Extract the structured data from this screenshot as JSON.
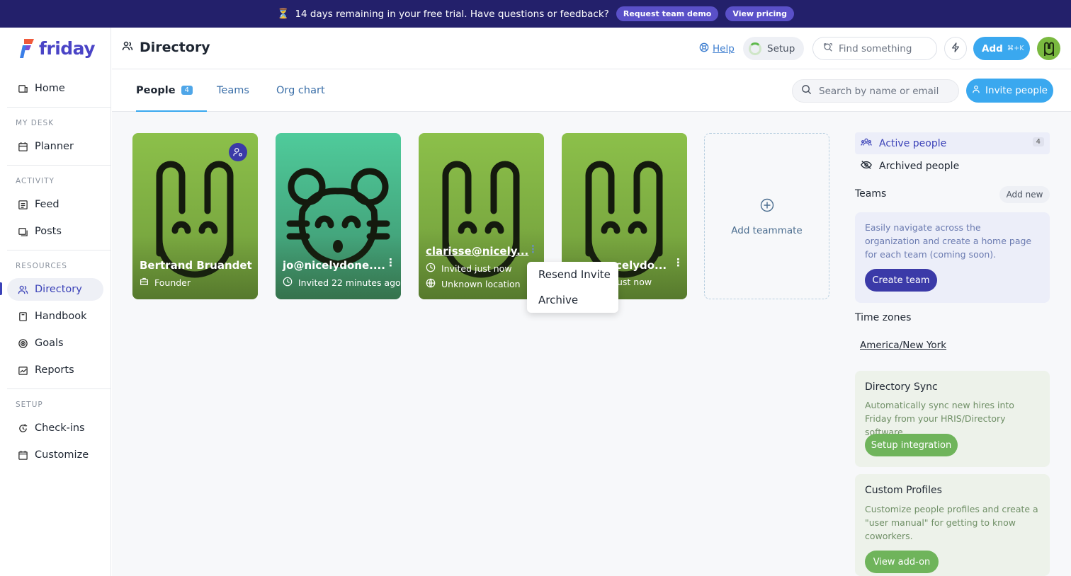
{
  "banner": {
    "message": "14 days remaining in your free trial. Have questions or feedback?",
    "demo_label": "Request team demo",
    "pricing_label": "View pricing"
  },
  "brand": {
    "name": "friday",
    "color": "#4a44c6"
  },
  "sidebar": {
    "home": "Home",
    "sections": [
      {
        "label": "MY DESK",
        "items": [
          "Planner"
        ]
      },
      {
        "label": "ACTIVITY",
        "items": [
          "Feed",
          "Posts"
        ]
      },
      {
        "label": "RESOURCES",
        "items": [
          "Directory",
          "Handbook",
          "Goals",
          "Reports"
        ]
      },
      {
        "label": "SETUP",
        "items": [
          "Check-ins",
          "Customize"
        ]
      }
    ],
    "active_item": "Directory"
  },
  "header": {
    "title": "Directory",
    "help_label": "Help",
    "setup_label": "Setup",
    "find_placeholder": "Find something",
    "add_label": "Add",
    "add_shortcut": "⌘+K"
  },
  "tabs": [
    {
      "label": "People",
      "count": "4",
      "active": true
    },
    {
      "label": "Teams"
    },
    {
      "label": "Org chart"
    }
  ],
  "search": {
    "placeholder": "Search by name or email"
  },
  "invite_label": "Invite people",
  "people": [
    {
      "name": "Bertrand Bruandet",
      "line1": "Founder"
    },
    {
      "name": "jo@nicelydone....",
      "line1": "Invited 22 minutes ago"
    },
    {
      "name": "clarisse@nicely...",
      "line1": "Invited just now",
      "line2": "Unknown location"
    },
    {
      "name": "celydo...",
      "line1": "ust now"
    }
  ],
  "add_teammate": "Add teammate",
  "context_menu": {
    "items": [
      "Resend Invite",
      "Archive"
    ]
  },
  "right_panel": {
    "active_people": "Active people",
    "active_count": "4",
    "archived_people": "Archived people",
    "teams_heading": "Teams",
    "add_new": "Add new",
    "teams_text": "Easily navigate across the organization and create a home page for each team (coming soon).",
    "create_team": "Create team",
    "timezones_heading": "Time zones",
    "timezone": "America/New York",
    "sync_heading": "Directory Sync",
    "sync_text": "Automatically sync new hires into Friday from your HRIS/Directory software.",
    "sync_button": "Setup integration",
    "profiles_heading": "Custom Profiles",
    "profiles_text": "Customize people profiles and create a \"user manual\" for getting to know coworkers.",
    "profiles_button": "View add-on"
  },
  "colors": {
    "banner_bg": "#23206b",
    "accent_blue": "#3aa8ef",
    "accent_purple": "#3b3aa8",
    "card_green": "#7ab940",
    "card_teal": "#4fc99a"
  }
}
